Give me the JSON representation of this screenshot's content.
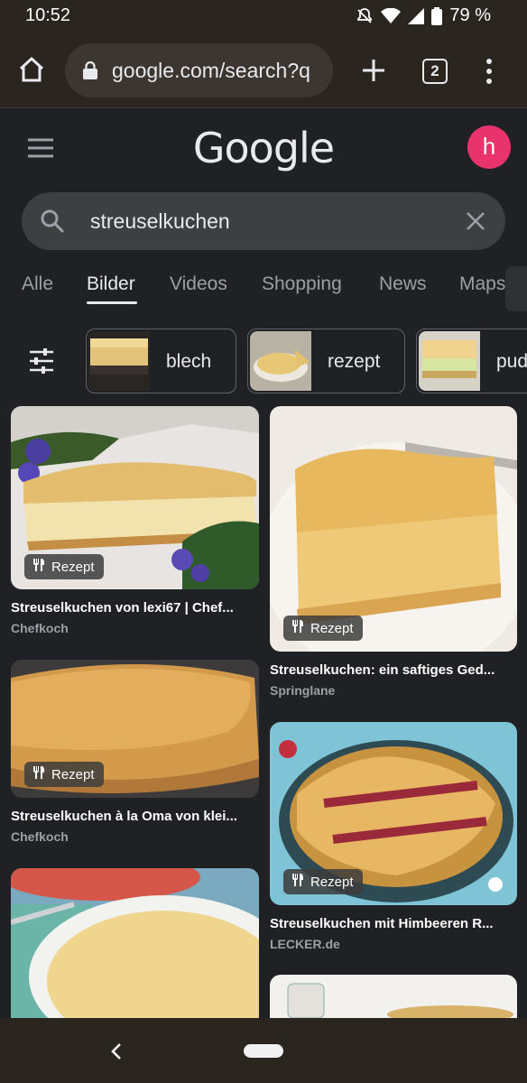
{
  "status": {
    "time": "10:52",
    "battery": "79 %"
  },
  "browser": {
    "url": "google.com/search?q",
    "tab_count": "2"
  },
  "google": {
    "logo": "Google",
    "avatar_initial": "h"
  },
  "search": {
    "query": "streuselkuchen"
  },
  "tabs": [
    {
      "label": "Alle",
      "active": false
    },
    {
      "label": "Bilder",
      "active": true
    },
    {
      "label": "Videos",
      "active": false
    },
    {
      "label": "Shopping",
      "active": false
    },
    {
      "label": "News",
      "active": false
    },
    {
      "label": "Maps",
      "active": false
    }
  ],
  "chips": [
    {
      "label": "blech"
    },
    {
      "label": "rezept"
    },
    {
      "label": "pud"
    }
  ],
  "results": [
    {
      "badge": "Rezept",
      "title": "Streuselkuchen von lexi67 | Chef...",
      "source": "Chefkoch"
    },
    {
      "badge": "Rezept",
      "title": "Streuselkuchen: ein saftiges Ged...",
      "source": "Springlane"
    },
    {
      "badge": "Rezept",
      "title": "Streuselkuchen à la Oma von klei...",
      "source": "Chefkoch"
    },
    {
      "badge": "Rezept",
      "title": "Streuselkuchen mit Himbeeren R...",
      "source": "LECKER.de"
    }
  ],
  "icons": {
    "home": "home-icon",
    "lock": "lock-icon",
    "plus": "plus-icon",
    "menu": "more-vert-icon",
    "search": "search-icon",
    "clear": "close-icon",
    "filter": "tune-icon",
    "recipe": "fork-knife-icon",
    "back": "back-icon"
  },
  "colors": {
    "avatar": "#e8336c",
    "background": "#202124",
    "searchbox": "#3c4043"
  }
}
